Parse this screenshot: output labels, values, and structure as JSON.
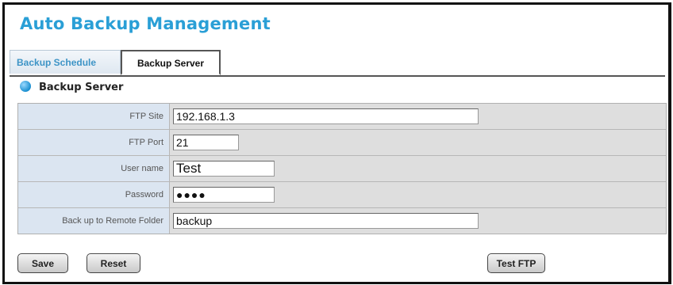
{
  "page_title": "Auto Backup Management",
  "tabs": [
    {
      "label": "Backup Schedule",
      "active": false
    },
    {
      "label": "Backup Server",
      "active": true
    }
  ],
  "section_title": "Backup Server",
  "fields": {
    "ftp_site": {
      "label": "FTP Site",
      "value": "192.168.1.3"
    },
    "ftp_port": {
      "label": "FTP Port",
      "value": "21"
    },
    "user_name": {
      "label": "User name",
      "value": "Test"
    },
    "password": {
      "label": "Password",
      "value": "●●●●"
    },
    "remote_folder": {
      "label": "Back up to Remote Folder",
      "value": "backup"
    }
  },
  "buttons": {
    "save": "Save",
    "reset": "Reset",
    "test_ftp": "Test FTP"
  },
  "colors": {
    "title": "#2a9fd6",
    "label_bg": "#dbe5f1",
    "value_bg": "#dedede"
  }
}
